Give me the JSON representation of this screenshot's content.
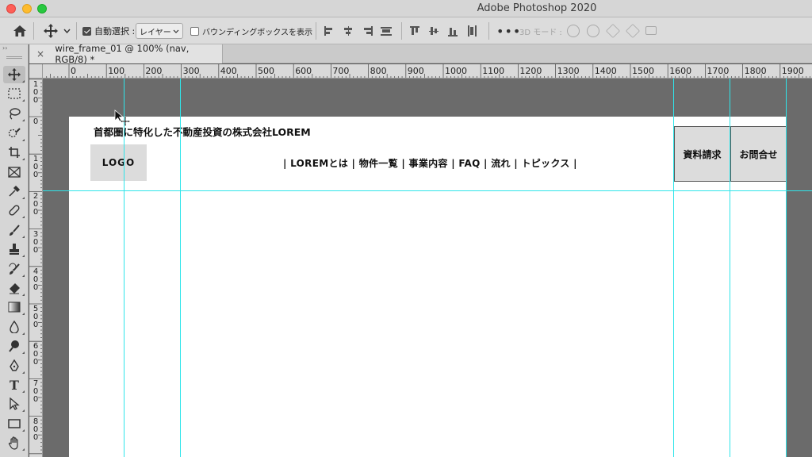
{
  "window": {
    "app_title": "Adobe Photoshop 2020"
  },
  "options_bar": {
    "auto_select_label": "自動選択 :",
    "auto_select_checked": true,
    "target_dropdown_value": "レイヤー",
    "bounding_box_label": "バウンディングボックスを表示",
    "bounding_box_checked": false,
    "more_label": "•••",
    "mode_3d_label": "3D モード :"
  },
  "document": {
    "tab_close": "×",
    "tab_label": "wire_frame_01 @ 100% (nav, RGB/8) *"
  },
  "ruler": {
    "horizontal_labels": [
      "0",
      "100",
      "200",
      "300",
      "400",
      "500",
      "600",
      "700",
      "800",
      "900",
      "1000",
      "1100",
      "1200",
      "1300",
      "1400",
      "1500",
      "1600",
      "1700",
      "1800",
      "1900"
    ],
    "vertical_labels": [
      "1\n0\n0",
      "0",
      "1\n0\n0",
      "2\n0\n0",
      "3\n0\n0",
      "4\n0\n0",
      "5\n0\n0",
      "6\n0\n0",
      "7\n0\n0",
      "8\n0\n0"
    ]
  },
  "wireframe": {
    "tagline": "首都圏に特化した不動産投資の株式会社LOREM",
    "logo": "LOGO",
    "nav_text": "| LOREMとは | 物件一覧 | 事業内容 | FAQ | 流れ | トピックス |",
    "button_request_docs": "資料請求",
    "button_contact": "お問合せ"
  },
  "colors": {
    "guide": "#2fe5ea",
    "pasteboard": "#6b6b6b",
    "canvas": "#ffffff"
  },
  "toolbar_icons": [
    "move-tool-icon",
    "marquee-tool-icon",
    "lasso-tool-icon",
    "quick-select-tool-icon",
    "crop-tool-icon",
    "frame-tool-icon",
    "eyedropper-tool-icon",
    "healing-brush-tool-icon",
    "brush-tool-icon",
    "clone-stamp-tool-icon",
    "history-brush-tool-icon",
    "eraser-tool-icon",
    "gradient-tool-icon",
    "blur-tool-icon",
    "dodge-tool-icon",
    "pen-tool-icon",
    "type-tool-icon",
    "path-select-tool-icon",
    "rectangle-tool-icon",
    "hand-tool-icon"
  ]
}
